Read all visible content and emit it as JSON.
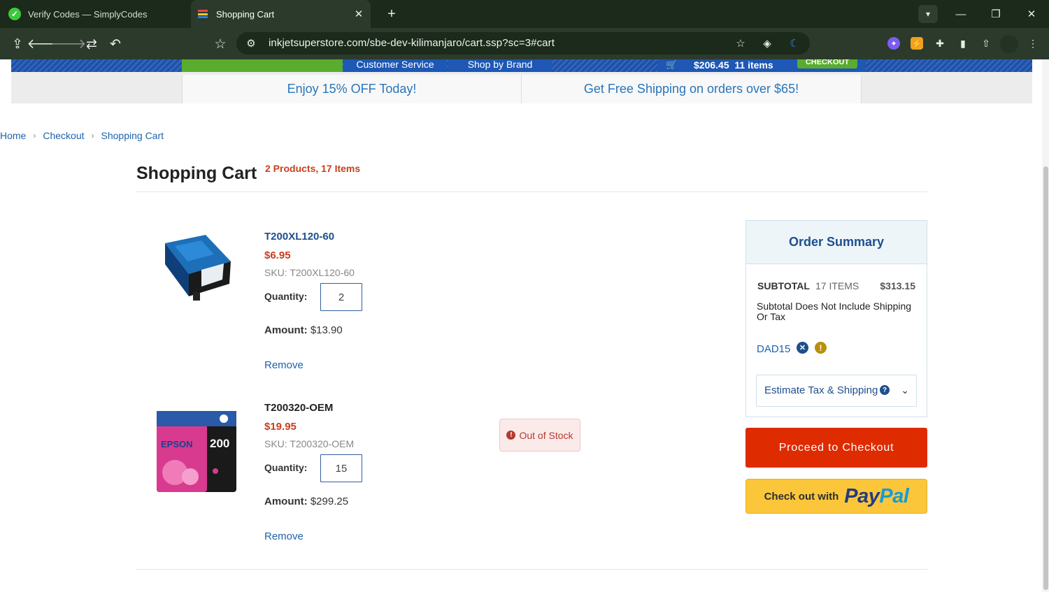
{
  "browser": {
    "tabs": [
      {
        "title": "Verify Codes — SimplyCodes"
      },
      {
        "title": "Shopping Cart"
      }
    ],
    "url": "inkjetsuperstore.com/sbe-dev-kilimanjaro/cart.ssp?sc=3#cart"
  },
  "site_nav": {
    "items": [
      "Customer Service",
      "Shop by Brand"
    ],
    "cart_total": "$206.45",
    "cart_items": "11 items",
    "checkout_label": "CHECKOUT"
  },
  "promos": [
    "Enjoy 15% OFF Today!",
    "Get Free Shipping on orders over $65!"
  ],
  "breadcrumb": [
    "Home",
    "Checkout",
    "Shopping Cart"
  ],
  "cart": {
    "title": "Shopping Cart",
    "count": "2 Products, 17 Items",
    "items": [
      {
        "name": "T200XL120-60",
        "price": "$6.95",
        "sku": "SKU: T200XL120-60",
        "qty_label": "Quantity:",
        "qty": "2",
        "amount_label": "Amount:",
        "amount": "$13.90",
        "remove": "Remove",
        "name_color": "#1e4f8c"
      },
      {
        "name": "T200320-OEM",
        "price": "$19.95",
        "sku": "SKU: T200320-OEM",
        "qty_label": "Quantity:",
        "qty": "15",
        "amount_label": "Amount:",
        "amount": "$299.25",
        "remove": "Remove",
        "stock": "Out of Stock",
        "name_color": "#222222"
      }
    ]
  },
  "summary": {
    "title": "Order Summary",
    "subtotal_label": "SUBTOTAL",
    "subtotal_items": "17 ITEMS",
    "subtotal": "$313.15",
    "note": "Subtotal Does Not Include Shipping Or Tax",
    "promo_code": "DAD15",
    "estimate_label": "Estimate Tax & Shipping",
    "checkout_button": "Proceed to Checkout",
    "paypal_prefix": "Check out with",
    "paypal_logo": "PayPal"
  },
  "colors": {
    "accent_blue": "#1e57b4",
    "link": "#1f63ad",
    "price": "#c8401e",
    "checkout": "#df2b00",
    "paypal_yellow": "#fbc63a"
  },
  "icons": [
    "check-circle-icon",
    "cart-favicon-icon",
    "close-icon",
    "plus-icon",
    "chevron-down-icon",
    "minimize-icon",
    "restore-icon",
    "home-icon",
    "back-arrow-icon",
    "forward-arrow-icon",
    "reload-icon",
    "undo-icon",
    "star-icon",
    "site-info-icon",
    "layers-icon",
    "moon-icon",
    "shopping-cart-icon",
    "exclamation-icon",
    "remove-circle-icon",
    "help-circle-icon"
  ]
}
